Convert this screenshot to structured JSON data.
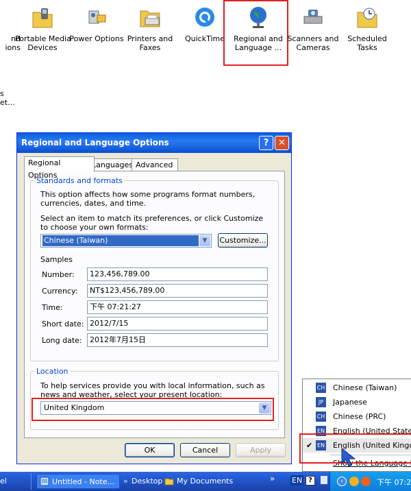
{
  "control_panel": {
    "items": [
      {
        "label": "nd\nions"
      },
      {
        "label": "Portable Media\nDevices"
      },
      {
        "label": "Power Options"
      },
      {
        "label": "Printers and\nFaxes"
      },
      {
        "label": "QuickTime"
      },
      {
        "label": "Regional and\nLanguage ..."
      },
      {
        "label": "Scanners and\nCameras"
      },
      {
        "label": "Scheduled\nTasks"
      }
    ],
    "side_text_1": "s",
    "side_text_2": "et..."
  },
  "dialog": {
    "title": "Regional and Language Options",
    "help_glyph": "?",
    "close_glyph": "✕",
    "tabs": [
      "Regional Options",
      "Languages",
      "Advanced"
    ],
    "standards": {
      "group_title": "Standards and formats",
      "description": "This option affects how some programs format numbers, currencies, dates, and time.",
      "select_prompt": "Select an item to match its preferences, or click Customize to choose your own formats:",
      "selected_format": "Chinese (Taiwan)",
      "customize_label": "Customize...",
      "samples_label": "Samples",
      "samples": [
        {
          "label": "Number:",
          "value": "123,456,789.00"
        },
        {
          "label": "Currency:",
          "value": "NT$123,456,789.00"
        },
        {
          "label": "Time:",
          "value": "下午 07:21:27"
        },
        {
          "label": "Short date:",
          "value": "2012/7/15"
        },
        {
          "label": "Long date:",
          "value": "2012年7月15日"
        }
      ]
    },
    "location": {
      "group_title": "Location",
      "description": "To help services provide you with local information, such as news and weather, select your present location:",
      "selected": "United Kingdom"
    },
    "buttons": {
      "ok": "OK",
      "cancel": "Cancel",
      "apply": "Apply"
    }
  },
  "language_popup": {
    "items": [
      {
        "code": "CH",
        "name": "Chinese (Taiwan)",
        "checked": false
      },
      {
        "code": "JP",
        "name": "Japanese",
        "checked": false
      },
      {
        "code": "CH",
        "name": "Chinese (PRC)",
        "checked": false
      },
      {
        "code": "EN",
        "name": "English (United States)",
        "checked": false
      },
      {
        "code": "EN",
        "name": "English (United Kingdom)",
        "checked": true
      }
    ],
    "check_glyph": "✔",
    "show_bar_label": "Show the Language bar"
  },
  "taskbar": {
    "left_fragment": "el",
    "notepad_task": "Untitled - Note...",
    "desktop_label": "Desktop",
    "my_documents_label": "My Documents",
    "chevron": "»",
    "lang_indicator": "EN",
    "clock": "下午 07:2"
  },
  "colors": {
    "highlight": "#e02020",
    "xp_blue": "#0a5fe0"
  }
}
